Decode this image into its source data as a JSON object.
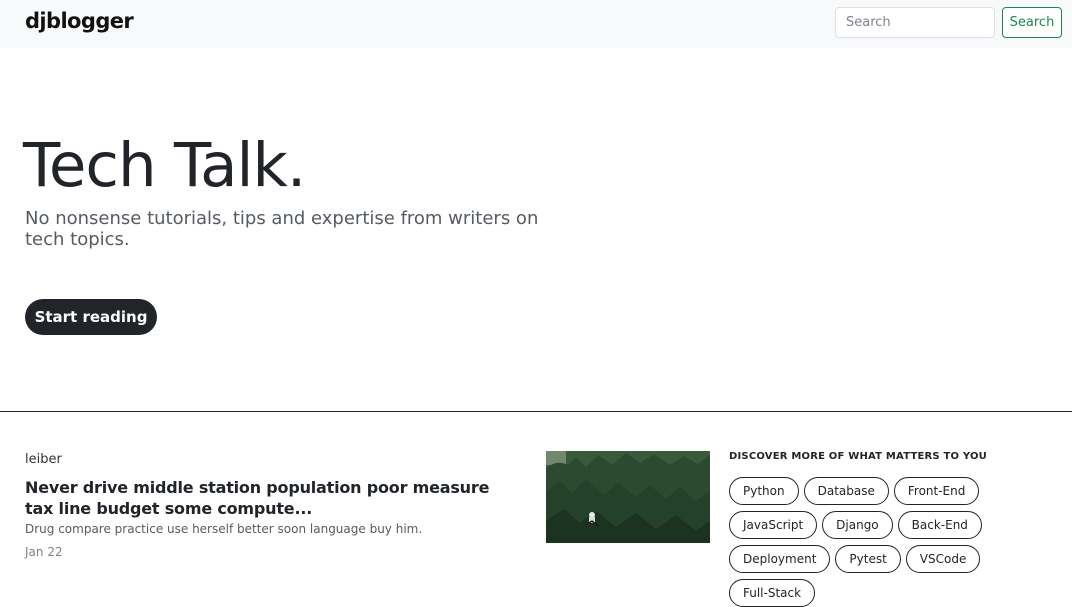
{
  "navbar": {
    "brand": "djblogger",
    "search_placeholder": "Search",
    "search_button_label": "Search"
  },
  "hero": {
    "title": "Tech Talk.",
    "subtitle": "No nonsense tutorials, tips and expertise from writers on tech topics.",
    "cta_label": "Start reading"
  },
  "post": {
    "author": "leiber",
    "title": "Never drive middle station population poor measure tax line budget some compute...",
    "excerpt": "Drug compare practice use herself better soon language buy him.",
    "date": "Jan 22",
    "colors": {
      "sky": "#8a9a86",
      "foliage": "#2c4a30",
      "highlight": "#e8ece8"
    }
  },
  "topics": {
    "heading": "DISCOVER MORE OF WHAT MATTERS TO YOU",
    "tags": [
      "Python",
      "Database",
      "Front-End",
      "JavaScript",
      "Django",
      "Back-End",
      "Deployment",
      "Pytest",
      "VSCode",
      "Full-Stack"
    ]
  },
  "colors": {
    "accent_green": "#198754",
    "dark": "#212529",
    "navbar_bg": "#f8f9fa"
  }
}
